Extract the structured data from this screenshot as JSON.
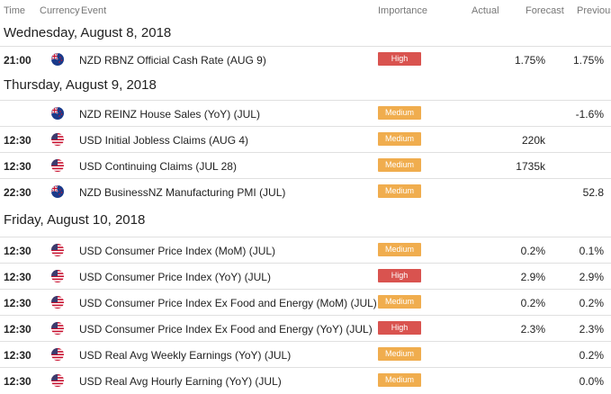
{
  "columns": {
    "time": "Time",
    "currency": "Currency",
    "event": "Event",
    "importance": "Importance",
    "actual": "Actual",
    "forecast": "Forecast",
    "previous": "Previous"
  },
  "colors": {
    "high": "#d9534f",
    "medium": "#f0ad4e",
    "row_divider": "#e0e0e0"
  },
  "days": [
    {
      "date": "Wednesday, August 8, 2018",
      "events": [
        {
          "time": "21:00",
          "flag": "nz-flag-icon",
          "event": "NZD RBNZ Official Cash Rate (AUG 9)",
          "importance": "High",
          "actual": "",
          "forecast": "1.75%",
          "previous": "1.75%"
        }
      ]
    },
    {
      "date": "Thursday, August 9, 2018",
      "events": [
        {
          "time": "",
          "flag": "nz-flag-icon",
          "event": "NZD REINZ House Sales (YoY) (JUL)",
          "importance": "Medium",
          "actual": "",
          "forecast": "",
          "previous": "-1.6%"
        },
        {
          "time": "12:30",
          "flag": "us-flag-icon",
          "event": "USD Initial Jobless Claims (AUG 4)",
          "importance": "Medium",
          "actual": "",
          "forecast": "220k",
          "previous": ""
        },
        {
          "time": "12:30",
          "flag": "us-flag-icon",
          "event": "USD Continuing Claims (JUL 28)",
          "importance": "Medium",
          "actual": "",
          "forecast": "1735k",
          "previous": ""
        },
        {
          "time": "22:30",
          "flag": "nz-flag-icon",
          "event": "NZD BusinessNZ Manufacturing PMI (JUL)",
          "importance": "Medium",
          "actual": "",
          "forecast": "",
          "previous": "52.8"
        }
      ]
    },
    {
      "date": "Friday, August 10, 2018",
      "events": [
        {
          "time": "12:30",
          "flag": "us-flag-icon",
          "event": "USD Consumer Price Index (MoM) (JUL)",
          "importance": "Medium",
          "actual": "",
          "forecast": "0.2%",
          "previous": "0.1%"
        },
        {
          "time": "12:30",
          "flag": "us-flag-icon",
          "event": "USD Consumer Price Index (YoY) (JUL)",
          "importance": "High",
          "actual": "",
          "forecast": "2.9%",
          "previous": "2.9%"
        },
        {
          "time": "12:30",
          "flag": "us-flag-icon",
          "event": "USD Consumer Price Index Ex Food and Energy (MoM) (JUL)",
          "importance": "Medium",
          "actual": "",
          "forecast": "0.2%",
          "previous": "0.2%"
        },
        {
          "time": "12:30",
          "flag": "us-flag-icon",
          "event": "USD Consumer Price Index Ex Food and Energy (YoY) (JUL)",
          "importance": "High",
          "actual": "",
          "forecast": "2.3%",
          "previous": "2.3%"
        },
        {
          "time": "12:30",
          "flag": "us-flag-icon",
          "event": "USD Real Avg Weekly Earnings (YoY) (JUL)",
          "importance": "Medium",
          "actual": "",
          "forecast": "",
          "previous": "0.2%"
        },
        {
          "time": "12:30",
          "flag": "us-flag-icon",
          "event": "USD Real Avg Hourly Earning (YoY) (JUL)",
          "importance": "Medium",
          "actual": "",
          "forecast": "",
          "previous": "0.0%"
        }
      ]
    }
  ]
}
